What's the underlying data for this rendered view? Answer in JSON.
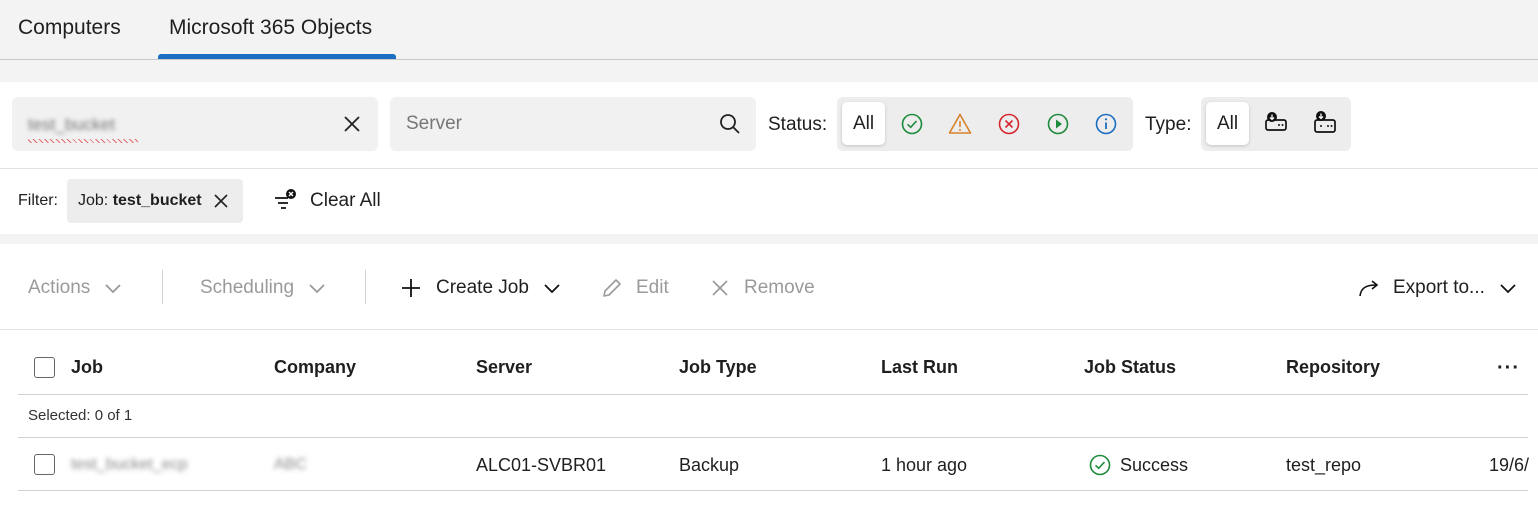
{
  "tabs": [
    {
      "label": "Computers",
      "active": false
    },
    {
      "label": "Microsoft 365 Objects",
      "active": true
    }
  ],
  "search": {
    "job_value": "test_bucket",
    "server_placeholder": "Server"
  },
  "status_filter": {
    "label": "Status:",
    "all_label": "All",
    "icons": [
      {
        "name": "success-icon",
        "color": "#1e8a3c"
      },
      {
        "name": "warning-icon",
        "color": "#d9822b"
      },
      {
        "name": "failed-icon",
        "color": "#d6262f"
      },
      {
        "name": "running-icon",
        "color": "#1e8a3c"
      },
      {
        "name": "info-icon",
        "color": "#1b6ec2"
      }
    ]
  },
  "type_filter": {
    "label": "Type:",
    "all_label": "All",
    "icons": [
      "backup-job-type-icon",
      "copy-job-type-icon"
    ]
  },
  "filters": {
    "label": "Filter:",
    "chip_key": "Job:",
    "chip_value": "test_bucket",
    "clear_all_label": "Clear All"
  },
  "toolbar": {
    "actions": "Actions",
    "scheduling": "Scheduling",
    "create_job": "Create Job",
    "edit": "Edit",
    "remove": "Remove",
    "export": "Export to..."
  },
  "grid": {
    "columns": [
      "Job",
      "Company",
      "Server",
      "Job Type",
      "Last Run",
      "Job Status",
      "Repository"
    ],
    "more_label": "···",
    "selected_text": "Selected: 0 of 1",
    "rows": [
      {
        "job": "test_bucket_ecp",
        "company": "ABC",
        "server": "ALC01-SVBR01",
        "job_type": "Backup",
        "last_run": "1 hour ago",
        "job_status": "Success",
        "repository": "test_repo",
        "overflow": "19/6/"
      }
    ]
  },
  "colors": {
    "accent": "#1b6ec2",
    "success": "#1e8a3c",
    "warning": "#d9822b",
    "error": "#d6262f"
  }
}
